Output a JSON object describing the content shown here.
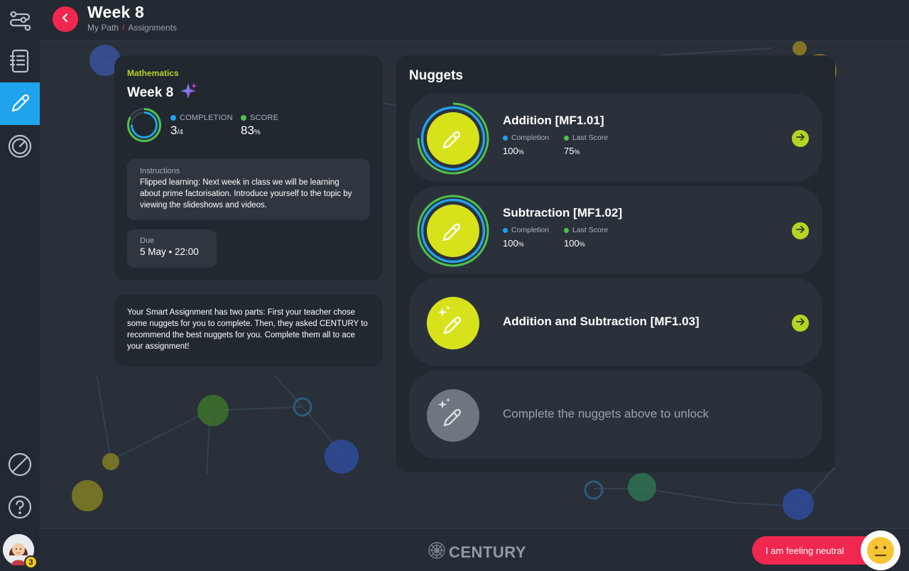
{
  "header": {
    "title": "Week 8",
    "breadcrumb": [
      "My Path",
      "Assignments"
    ]
  },
  "sidebar": {
    "items": [
      {
        "name": "path-icon",
        "active": false
      },
      {
        "name": "notebook-icon",
        "active": false
      },
      {
        "name": "pencil-icon",
        "active": true
      },
      {
        "name": "dashboard-icon",
        "active": false
      }
    ],
    "bottom": [
      "slash-circle-icon",
      "help-icon"
    ],
    "avatar_badge": "3"
  },
  "assignment": {
    "subject": "Mathematics",
    "title": "Week 8",
    "completion_label": "COMPLETION",
    "completion_value": "3",
    "completion_total": "/4",
    "completion_fraction": 0.75,
    "score_label": "SCORE",
    "score_value": "83",
    "score_unit": "%",
    "score_fraction": 0.83,
    "instructions_label": "Instructions",
    "instructions_text": "Flipped learning: Next week in class we will be learning about prime factorisation. Introduce yourself to the topic by viewing the slideshows and videos.",
    "due_label": "Due",
    "due_value": "5 May • 22:00"
  },
  "smart_text": "Your Smart Assignment has two parts: First your teacher chose some nuggets for you to complete. Then, they asked CENTURY to recommend the best nuggets for you. Complete them all to ace your assignment!",
  "nuggets": {
    "title": "Nuggets",
    "items": [
      {
        "name": "Addition [MF1.01]",
        "completion_label": "Completion",
        "completion_value": "100",
        "last_score_label": "Last Score",
        "last_score_value": "75",
        "unit": "%"
      },
      {
        "name": "Subtraction [MF1.02]",
        "completion_label": "Completion",
        "completion_value": "100",
        "last_score_label": "Last Score",
        "last_score_value": "100",
        "unit": "%"
      },
      {
        "name": "Addition and Subtraction [MF1.03]"
      },
      {
        "name": "Complete the nuggets above to unlock"
      }
    ]
  },
  "footer": {
    "brand": "CENTURY",
    "mood_label": "I am feeling neutral"
  },
  "colors": {
    "accent_red": "#f0274f",
    "accent_blue": "#1ea3ec",
    "completion_blue": "#1ea3ec",
    "score_green": "#4fc24a",
    "nugget_yellow": "#d7e21a",
    "go_green": "#b5d323"
  }
}
